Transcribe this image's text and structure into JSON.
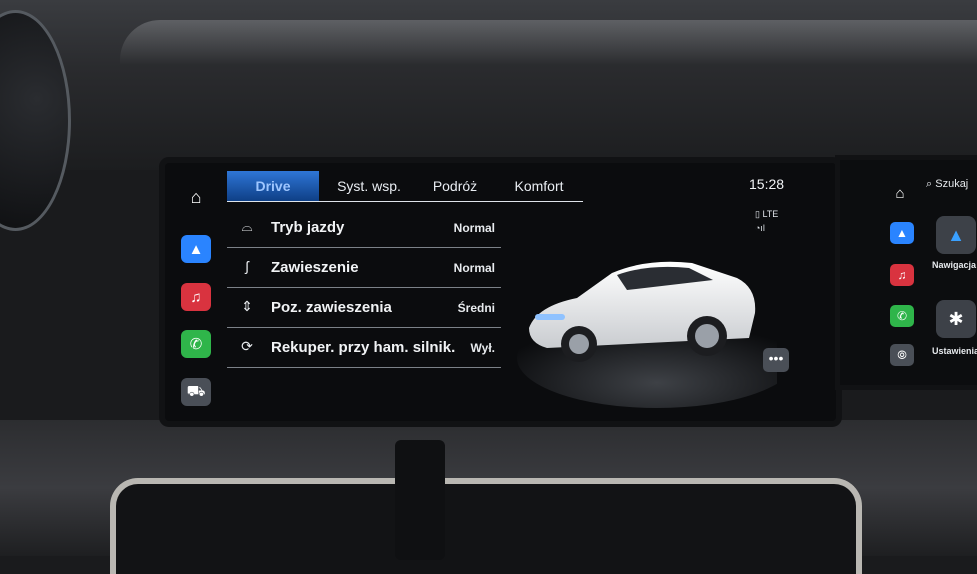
{
  "tabs": [
    {
      "label": "Drive",
      "active": true
    },
    {
      "label": "Syst. wsp.",
      "active": false
    },
    {
      "label": "Podróż",
      "active": false
    },
    {
      "label": "Komfort",
      "active": false
    }
  ],
  "settings": [
    {
      "icon": "car-outline-icon",
      "label": "Tryb jazdy",
      "value": "Normal"
    },
    {
      "icon": "suspension-spring-icon",
      "label": "Zawieszenie",
      "value": "Normal"
    },
    {
      "icon": "car-lift-icon",
      "label": "Poz. zawieszenia",
      "value": "Średni"
    },
    {
      "icon": "recuperation-icon",
      "label": "Rekuper. przy ham. silnik.",
      "value": "Wył."
    }
  ],
  "status": {
    "time": "15:28",
    "network": "LTE"
  },
  "side_screen": {
    "search_label": "Szukaj",
    "tiles": [
      {
        "label": "Nawigacja",
        "icon": "navigation-arrow-icon"
      },
      {
        "label": "Ustawienia",
        "icon": "settings-gear-icon"
      }
    ]
  },
  "colors": {
    "accent": "#1f64c9",
    "nav": "#2a84ff",
    "music": "#d9333f",
    "phone": "#2fb54a"
  }
}
